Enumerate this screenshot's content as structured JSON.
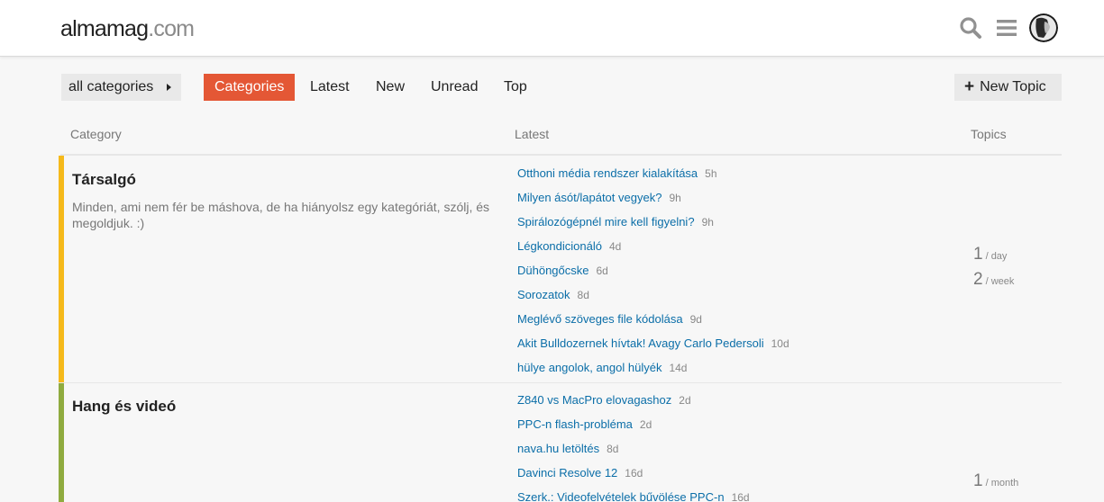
{
  "header": {
    "logo_part1": "almamag",
    "logo_part2": ".com"
  },
  "nav": {
    "category_dropdown": "all categories",
    "tabs": [
      {
        "label": "Categories"
      },
      {
        "label": "Latest"
      },
      {
        "label": "New"
      },
      {
        "label": "Unread"
      },
      {
        "label": "Top"
      }
    ],
    "new_topic_label": "New Topic"
  },
  "table": {
    "col_category": "Category",
    "col_latest": "Latest",
    "col_topics": "Topics"
  },
  "categories": [
    {
      "name": "Társalgó",
      "description": "Minden, ami nem fér be máshova, de ha hiányolsz egy kategóriát, szólj, és megoldjuk. :)",
      "color": "#f5b91b",
      "topics": [
        {
          "title": "Otthoni média rendszer kialakítása",
          "age": "5h"
        },
        {
          "title": "Milyen ásót/lapátot vegyek?",
          "age": "9h"
        },
        {
          "title": "Spirálozógépnél mire kell figyelni?",
          "age": "9h"
        },
        {
          "title": "Légkondicionáló",
          "age": "4d"
        },
        {
          "title": "Dühöngőcske",
          "age": "6d"
        },
        {
          "title": "Sorozatok",
          "age": "8d"
        },
        {
          "title": "Meglévő szöveges file kódolása",
          "age": "9d"
        },
        {
          "title": "Akit Bulldozernek hívtak! Avagy Carlo Pedersoli",
          "age": "10d"
        },
        {
          "title": "hülye angolok, angol hülyék",
          "age": "14d"
        }
      ],
      "stats": [
        {
          "num": "1",
          "unit": "/ day"
        },
        {
          "num": "2",
          "unit": "/ week"
        }
      ]
    },
    {
      "name": "Hang és videó",
      "description": "",
      "color": "#8fab3f",
      "topics": [
        {
          "title": "Z840 vs MacPro elovagashoz",
          "age": "2d"
        },
        {
          "title": "PPC-n flash-probléma",
          "age": "2d"
        },
        {
          "title": "nava.hu letöltés",
          "age": "8d"
        },
        {
          "title": "Davinci Resolve 12",
          "age": "16d"
        },
        {
          "title": "Szerk.: Videofelvételek bűvölése PPC-n",
          "age": "16d"
        }
      ],
      "stats": [
        {
          "num": "1",
          "unit": "/ month"
        }
      ]
    }
  ],
  "icons": {
    "search": "search-icon",
    "menu": "hamburger-menu-icon",
    "avatar": "user-avatar"
  }
}
